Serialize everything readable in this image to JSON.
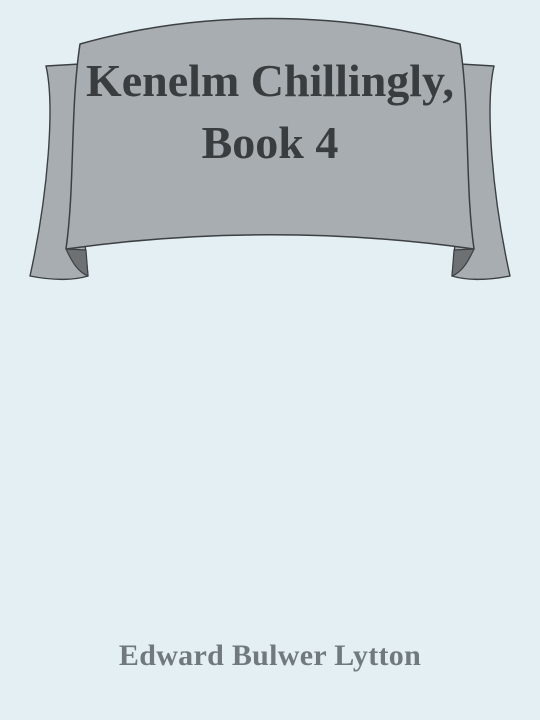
{
  "book": {
    "title": "Kenelm Chillingly, Book 4",
    "author": "Edward Bulwer Lytton"
  },
  "colors": {
    "background": "#e4eff4",
    "banner_fill": "#a7adb0",
    "banner_shadow": "#6d7174",
    "banner_outline": "#3c4043",
    "title_text": "#3a3d40",
    "author_text": "#707a7e"
  },
  "icons": {
    "banner": "ribbon-banner"
  }
}
